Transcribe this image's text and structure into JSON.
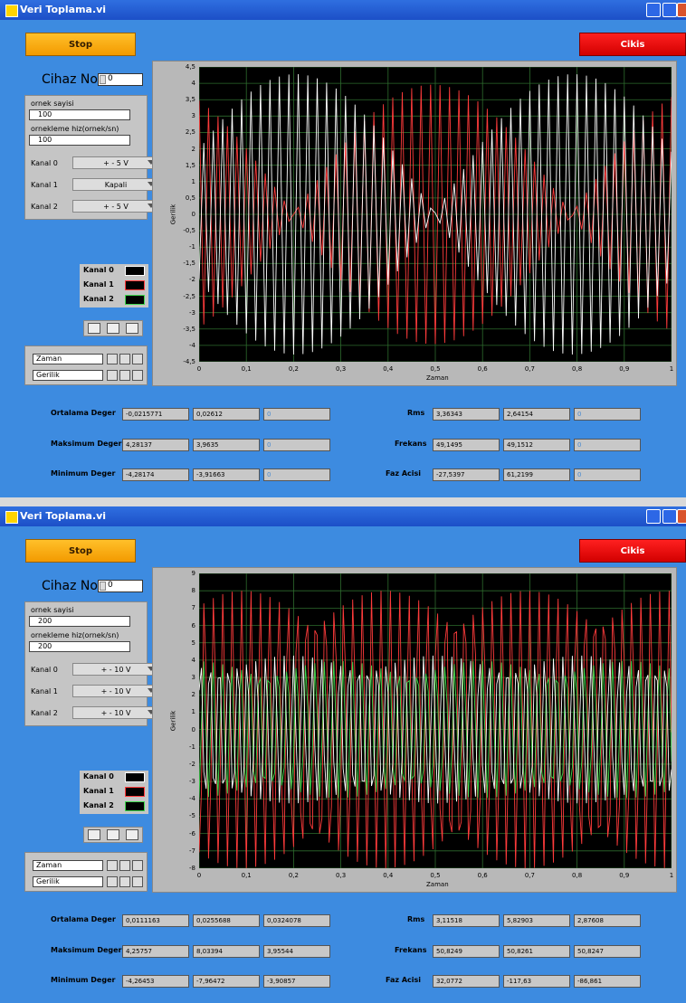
{
  "windows": [
    {
      "title": "Veri Toplama.vi",
      "stop": "Stop",
      "cikis": "Cikis",
      "cihaz_label": "Cihaz No",
      "cihaz_value": "0",
      "ornek_label": "ornek sayisi",
      "ornek_value": "100",
      "hiz_label": "ornekleme hiz(ornek/sn)",
      "hiz_value": "100",
      "kanallar": [
        {
          "label": "Kanal 0",
          "value": "+ - 5 V"
        },
        {
          "label": "Kanal 1",
          "value": "Kapali"
        },
        {
          "label": "Kanal 2",
          "value": "+ - 5 V"
        }
      ],
      "legend": [
        "Kanal 0",
        "Kanal 1",
        "Kanal 2"
      ],
      "axis_names": [
        "Zaman",
        "Gerilik"
      ],
      "plot": {
        "xlabel": "Zaman",
        "ylabel": "Gerilik",
        "ymin": -4.5,
        "ymax": 4.5,
        "yticks": [
          "4,5",
          "4",
          "3,5",
          "3",
          "2,5",
          "2",
          "1,5",
          "1",
          "0,5",
          "0",
          "-0,5",
          "-1",
          "-1,5",
          "-2",
          "-2,5",
          "-3",
          "-3,5",
          "-4",
          "-4,5"
        ],
        "xticks": [
          "0",
          "0,1",
          "0,2",
          "0,3",
          "0,4",
          "0,5",
          "0,6",
          "0,7",
          "0,8",
          "0,9",
          "1"
        ]
      },
      "stats": {
        "ortalama": {
          "label": "Ortalama Deger",
          "values": [
            "-0,0215771",
            "0,02612",
            "0"
          ]
        },
        "maksimum": {
          "label": "Maksimum Deger",
          "values": [
            "4,28137",
            "3,9635",
            "0"
          ]
        },
        "minimum": {
          "label": "Minimum Deger",
          "values": [
            "-4,28174",
            "-3,91663",
            "0"
          ]
        },
        "rms": {
          "label": "Rms",
          "values": [
            "3,36343",
            "2,64154",
            "0"
          ]
        },
        "frekans": {
          "label": "Frekans",
          "values": [
            "49,1495",
            "49,1512",
            "0"
          ]
        },
        "faz": {
          "label": "Faz Acisi",
          "values": [
            "-27,5397",
            "61,2199",
            "0"
          ]
        }
      }
    },
    {
      "title": "Veri Toplama.vi",
      "stop": "Stop",
      "cikis": "Cikis",
      "cihaz_label": "Cihaz No",
      "cihaz_value": "0",
      "ornek_label": "ornek sayisi",
      "ornek_value": "200",
      "hiz_label": "ornekleme hiz(ornek/sn)",
      "hiz_value": "200",
      "kanallar": [
        {
          "label": "Kanal 0",
          "value": "+ - 10 V"
        },
        {
          "label": "Kanal 1",
          "value": "+ - 10 V"
        },
        {
          "label": "Kanal 2",
          "value": "+ - 10 V"
        }
      ],
      "legend": [
        "Kanal 0",
        "Kanal 1",
        "Kanal 2"
      ],
      "axis_names": [
        "Zaman",
        "Gerilik"
      ],
      "plot": {
        "xlabel": "Zaman",
        "ylabel": "Gerilik",
        "ymin": -8,
        "ymax": 9,
        "yticks": [
          "9",
          "8",
          "7",
          "6",
          "5",
          "4",
          "3",
          "2",
          "1",
          "0",
          "-1",
          "-2",
          "-3",
          "-4",
          "-5",
          "-6",
          "-7",
          "-8"
        ],
        "xticks": [
          "0",
          "0,1",
          "0,2",
          "0,3",
          "0,4",
          "0,5",
          "0,6",
          "0,7",
          "0,8",
          "0,9",
          "1"
        ]
      },
      "stats": {
        "ortalama": {
          "label": "Ortalama Deger",
          "values": [
            "0,0111163",
            "0,0255688",
            "0,0324078"
          ]
        },
        "maksimum": {
          "label": "Maksimum Deger",
          "values": [
            "4,25757",
            "8,03394",
            "3,95544"
          ]
        },
        "minimum": {
          "label": "Minimum Deger",
          "values": [
            "-4,26453",
            "-7,96472",
            "-3,90857"
          ]
        },
        "rms": {
          "label": "Rms",
          "values": [
            "3,11518",
            "5,82903",
            "2,87608"
          ]
        },
        "frekans": {
          "label": "Frekans",
          "values": [
            "50,8249",
            "50,8261",
            "50,8247"
          ]
        },
        "faz": {
          "label": "Faz Acisi",
          "values": [
            "32,0772",
            "-117,63",
            "-86,861"
          ]
        }
      }
    }
  ],
  "colors": {
    "kanal0": "#ffffff",
    "kanal1": "#ff3b3b",
    "kanal2": "#3fd84f",
    "grid": "#2d6b2d"
  }
}
